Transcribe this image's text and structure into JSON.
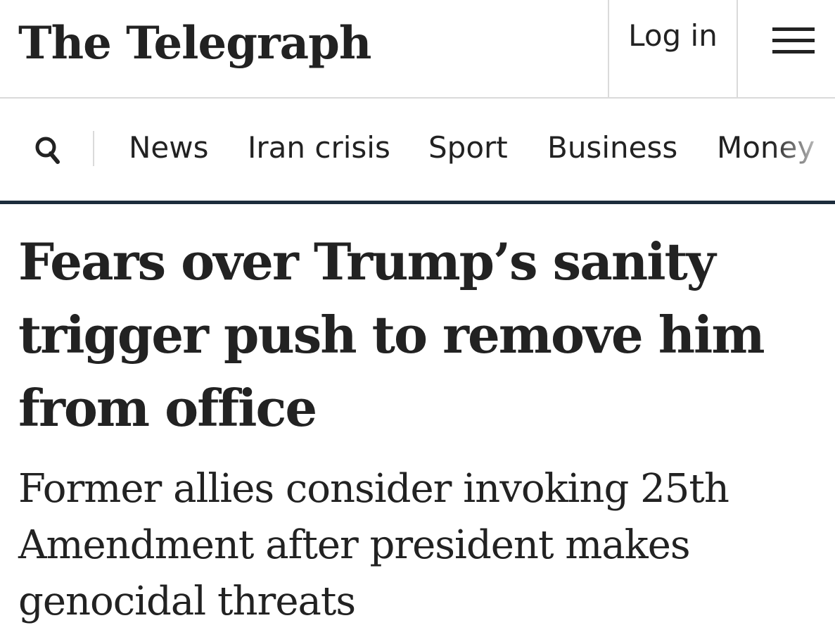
{
  "masthead": {
    "logo_text": "The Telegraph",
    "login_label": "Log in",
    "menu_icon": "hamburger-menu-icon"
  },
  "nav": {
    "search_icon": "search-icon",
    "items": [
      {
        "label": "News"
      },
      {
        "label": "Iran crisis"
      },
      {
        "label": "Sport"
      },
      {
        "label": "Business"
      },
      {
        "label": "Money"
      }
    ],
    "underline_color": "#1c2c3c"
  },
  "article": {
    "headline": "Fears over Trump’s sanity trigger push to remove him from office",
    "standfirst": "Former allies consider invoking 25th Amendment after president makes genocidal threats"
  }
}
